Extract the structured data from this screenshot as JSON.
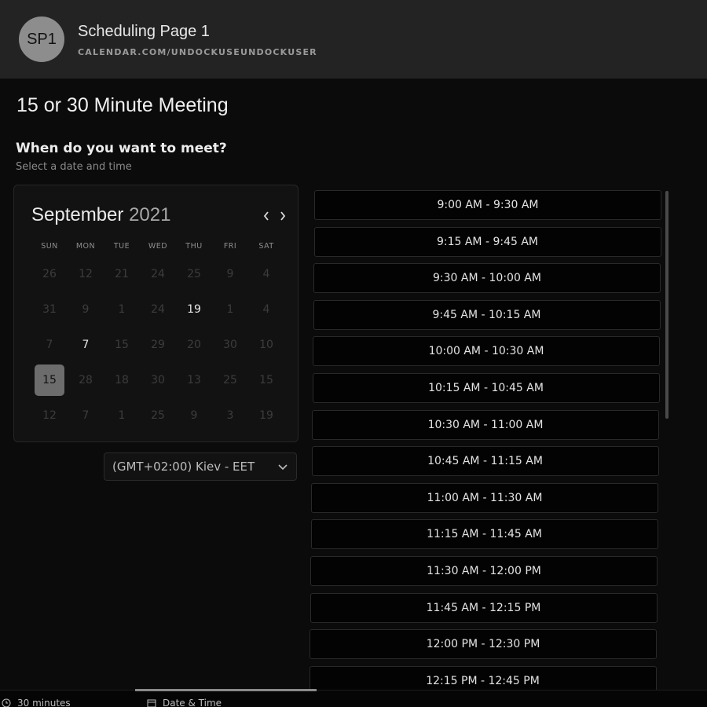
{
  "header": {
    "avatar_initials": "SP1",
    "title": "Scheduling Page 1",
    "url": "CALENDAR.COM/UNDOCKUSEUNDOCKUSER"
  },
  "meeting_title": "15 or 30 Minute Meeting",
  "question": {
    "title": "When do you want to meet?",
    "subtitle": "Select a date and time"
  },
  "calendar": {
    "month": "September",
    "year": "2021",
    "prev_icon": "chevron-left-icon",
    "next_icon": "chevron-right-icon",
    "weekdays": [
      "SUN",
      "MON",
      "TUE",
      "WED",
      "THU",
      "FRI",
      "SAT"
    ],
    "rows": [
      [
        {
          "d": "26"
        },
        {
          "d": "12"
        },
        {
          "d": "21"
        },
        {
          "d": "24"
        },
        {
          "d": "25"
        },
        {
          "d": "9"
        },
        {
          "d": "4"
        }
      ],
      [
        {
          "d": "31"
        },
        {
          "d": "9"
        },
        {
          "d": "1"
        },
        {
          "d": "24"
        },
        {
          "d": "19",
          "avail": true
        },
        {
          "d": "1"
        },
        {
          "d": "4"
        }
      ],
      [
        {
          "d": "7"
        },
        {
          "d": "7",
          "avail": true
        },
        {
          "d": "15"
        },
        {
          "d": "29"
        },
        {
          "d": "20"
        },
        {
          "d": "30"
        },
        {
          "d": "10"
        }
      ],
      [
        {
          "d": "15",
          "selected": true
        },
        {
          "d": "28"
        },
        {
          "d": "18"
        },
        {
          "d": "30"
        },
        {
          "d": "13"
        },
        {
          "d": "25"
        },
        {
          "d": "15"
        }
      ],
      [
        {
          "d": "12"
        },
        {
          "d": "7"
        },
        {
          "d": "1"
        },
        {
          "d": "25"
        },
        {
          "d": "9"
        },
        {
          "d": "3"
        },
        {
          "d": "19"
        }
      ]
    ]
  },
  "timezone": {
    "value": "(GMT+02:00) Kiev - EET",
    "icon": "chevron-down-icon"
  },
  "time_slots": [
    "9:00 AM - 9:30 AM",
    "9:15 AM - 9:45 AM",
    "9:30 AM - 10:00 AM",
    "9:45 AM - 10:15 AM",
    "10:00 AM - 10:30 AM",
    "10:15 AM - 10:45 AM",
    "10:30 AM - 11:00 AM",
    "10:45 AM - 11:15 AM",
    "11:00 AM - 11:30 AM",
    "11:15 AM - 11:45 AM",
    "11:30 AM - 12:00 PM",
    "11:45 AM - 12:15 PM",
    "12:00 PM - 12:30 PM",
    "12:15 PM - 12:45 PM"
  ],
  "footer": {
    "duration": "30 minutes",
    "duration_icon": "clock-icon",
    "date_time": "Date & Time",
    "date_time_icon": "calendar-icon"
  },
  "colors": {
    "background": "#0b0b0b",
    "header": "#232323",
    "selected_day": "#6c6c6c"
  }
}
